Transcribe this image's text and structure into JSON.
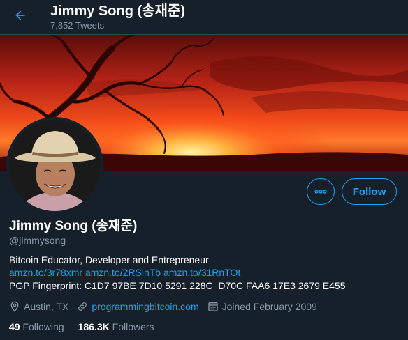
{
  "header": {
    "title": "Jimmy Song (송재준)",
    "tweet_count": "7,852 Tweets",
    "back_icon": "arrow-left-icon"
  },
  "colors": {
    "accent": "#1da1f2",
    "background": "#15202b",
    "muted_text": "#8899a6"
  },
  "actions": {
    "more_icon": "ellipsis-icon",
    "follow_label": "Follow"
  },
  "profile": {
    "name": "Jimmy Song (송재준)",
    "handle": "@jimmysong",
    "bio": "Bitcoin Educator, Developer and Entrepreneur",
    "bio_links": [
      "amzn.to/3r78xmr",
      "amzn.to/2RSlnTb",
      "amzn.to/31RnTOt"
    ],
    "pgp": "PGP Fingerprint: C1D7 97BE 7D10 5291 228C  D70C FAA6 17E3 2679 E455",
    "location": "Austin, TX",
    "website": "programmingbitcoin.com",
    "joined": "Joined February 2009"
  },
  "stats": {
    "following_count": "49",
    "following_label": "Following",
    "followers_count": "186.3K",
    "followers_label": "Followers"
  }
}
